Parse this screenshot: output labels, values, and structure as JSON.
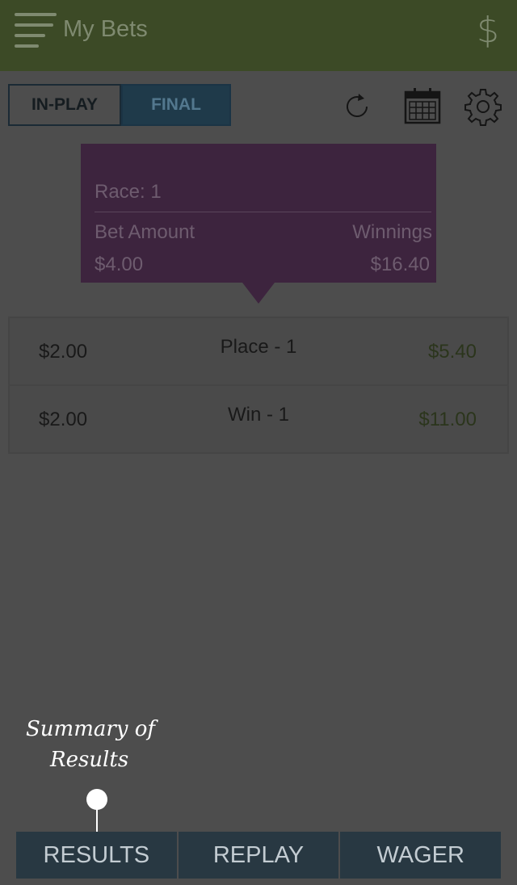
{
  "header": {
    "title": "My Bets",
    "currency_icon": "$"
  },
  "toggle": {
    "in_play": "IN-PLAY",
    "final": "FINAL"
  },
  "popup": {
    "race": "Race: 1",
    "bet_amount_label": "Bet Amount",
    "winnings_label": "Winnings",
    "bet_amount": "$4.00",
    "winnings": "$16.40"
  },
  "bets": [
    {
      "amount": "$2.00",
      "type": "Place - 1",
      "winnings": "$5.40"
    },
    {
      "amount": "$2.00",
      "type": "Win - 1",
      "winnings": "$11.00"
    }
  ],
  "annotation": {
    "line1": "Summary of",
    "line2": "Results"
  },
  "tabs": {
    "results": "RESULTS",
    "replay": "REPLAY",
    "wager": "WAGER"
  },
  "colors": {
    "header": "#3c4a26",
    "popup": "#3d243e",
    "tabbar": "#283842",
    "final_tab": "#1f3a4a"
  }
}
